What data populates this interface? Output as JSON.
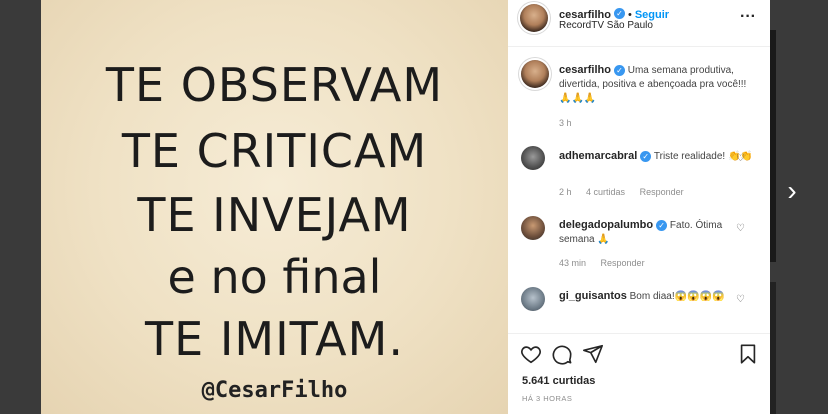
{
  "post": {
    "image_lines": [
      "TE OBSERVAM",
      "TE CRITICAM",
      "TE INVEJAM",
      "e no final",
      "TE IMITAM."
    ],
    "image_signature": "@CesarFilho"
  },
  "header": {
    "username": "cesarfilho",
    "separator": "•",
    "follow_label": "Seguir",
    "location": "RecordTV São Paulo",
    "more_icon": "ellipsis-icon"
  },
  "caption": {
    "username": "cesarfilho",
    "text": "Uma semana produtiva, divertida, positiva e abençoada pra você!!! 🙏🙏🙏",
    "time": "3 h"
  },
  "comments": [
    {
      "username": "adhemarcabral",
      "text": "Triste realidade! 👏👏",
      "time": "2 h",
      "likes": "4 curtidas",
      "reply": "Responder"
    },
    {
      "username": "delegadopalumbo",
      "text": "Fato. Ótima semana 🙏",
      "time": "43 min",
      "likes": "",
      "reply": "Responder"
    },
    {
      "username": "gi_guisantos",
      "text": "Bom diaa!😱😱😱😱",
      "time": "",
      "likes": "",
      "reply": ""
    }
  ],
  "footer": {
    "likes": "5.641 curtidas",
    "post_time": "HÁ 3 HORAS"
  },
  "colors": {
    "accent": "#0095f6",
    "verified": "#3897f0",
    "text": "#262626",
    "muted": "#8e8e8e"
  }
}
